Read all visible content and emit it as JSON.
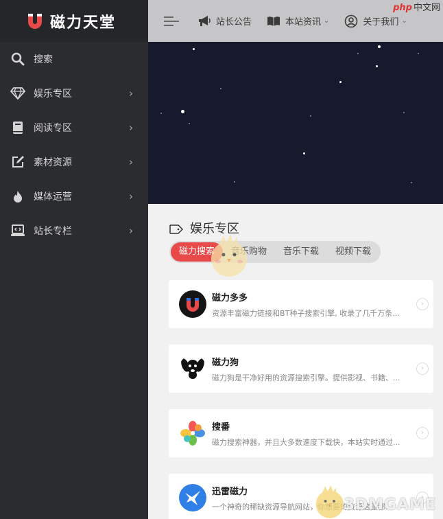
{
  "logo": {
    "text": "磁力天堂",
    "brand_color": "#e84a4a"
  },
  "sidebar": {
    "items": [
      {
        "label": "搜索",
        "icon": "search-icon",
        "has_arrow": false
      },
      {
        "label": "娱乐专区",
        "icon": "diamond-icon",
        "has_arrow": true
      },
      {
        "label": "阅读专区",
        "icon": "book-icon",
        "has_arrow": true
      },
      {
        "label": "素材资源",
        "icon": "edit-icon",
        "has_arrow": true
      },
      {
        "label": "媒体运营",
        "icon": "flame-icon",
        "has_arrow": true
      },
      {
        "label": "站长专栏",
        "icon": "laptop-icon",
        "has_arrow": true
      }
    ],
    "arrow": "›"
  },
  "topbar": {
    "announce": "站长公告",
    "info": "本站资讯",
    "about": "关于我们",
    "caret": "⌄"
  },
  "watermark": {
    "php": "php",
    "cn": "中文网",
    "bottom": "3DMGAME"
  },
  "section": {
    "title": "娱乐专区",
    "tabs": [
      "磁力搜索",
      "音乐购物",
      "音乐下载",
      "视频下载"
    ],
    "active_tab": 0
  },
  "cards": [
    {
      "title": "磁力多多",
      "desc": "资源丰富磁力链接和BT种子搜索引擎, 收录了几千万条...",
      "icon": "magnet-duoduo-icon"
    },
    {
      "title": "磁力狗",
      "desc": "磁力狗是干净好用的资源搜索引擎。提供影视、书籍、...",
      "icon": "dog-icon"
    },
    {
      "title": "搜番",
      "desc": "磁力搜索神器，并且大多数速度下载快，本站实时通过...",
      "icon": "pinwheel-icon"
    },
    {
      "title": "迅雷磁力",
      "desc": "一个神奇的稀缺资源导航网站，你想要的资源这里都...",
      "icon": "thunder-bird-icon"
    }
  ],
  "card_arrow": "›"
}
